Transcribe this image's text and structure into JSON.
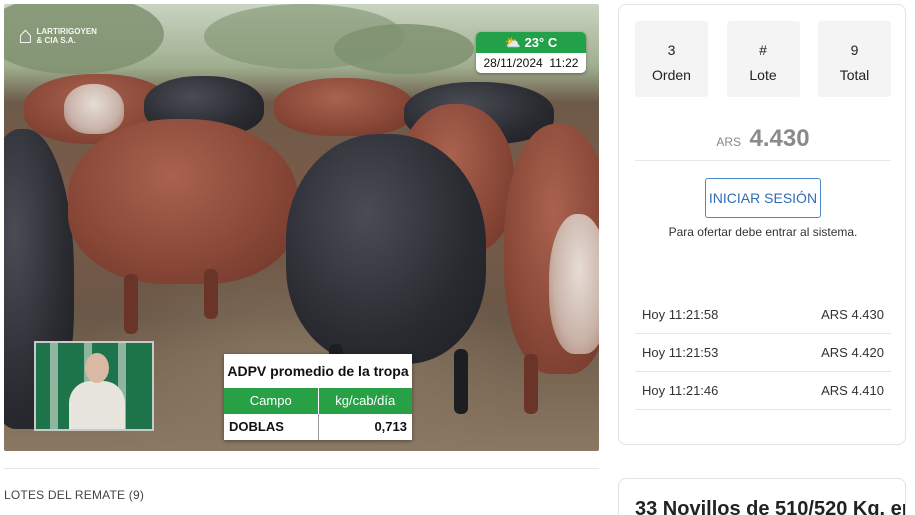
{
  "video": {
    "logo_line1": "LARTIRIGOYEN",
    "logo_line2": "& CIA S.A.",
    "weather": {
      "temperature": "23° C",
      "icon": "sun-cloud-icon",
      "datetime": "28/11/2024  11:22"
    },
    "adpv": {
      "title": "ADPV promedio de la tropa",
      "col1_header": "Campo",
      "col2_header": "kg/cab/día",
      "campo": "DOBLAS",
      "value": "0,713"
    }
  },
  "lotes": {
    "title": "LOTES DEL REMATE (9)"
  },
  "panel": {
    "stats": [
      {
        "top": "3",
        "label": "Orden"
      },
      {
        "top": "#",
        "label": "Lote"
      },
      {
        "top": "9",
        "label": "Total"
      }
    ],
    "price": {
      "currency": "ARS",
      "amount": "4.430"
    },
    "login_button": "INICIAR SESIÓN",
    "login_note": "Para ofertar debe entrar al sistema.",
    "bids": [
      {
        "time": "Hoy 11:21:58",
        "amount": "ARS 4.430"
      },
      {
        "time": "Hoy 11:21:53",
        "amount": "ARS 4.420"
      },
      {
        "time": "Hoy 11:21:46",
        "amount": "ARS 4.410"
      }
    ]
  },
  "lot_card": {
    "title": "33 Novillos de 510/520 Kg. en"
  },
  "colors": {
    "accent_green": "#22a04a",
    "button_blue": "#2e6db4"
  }
}
